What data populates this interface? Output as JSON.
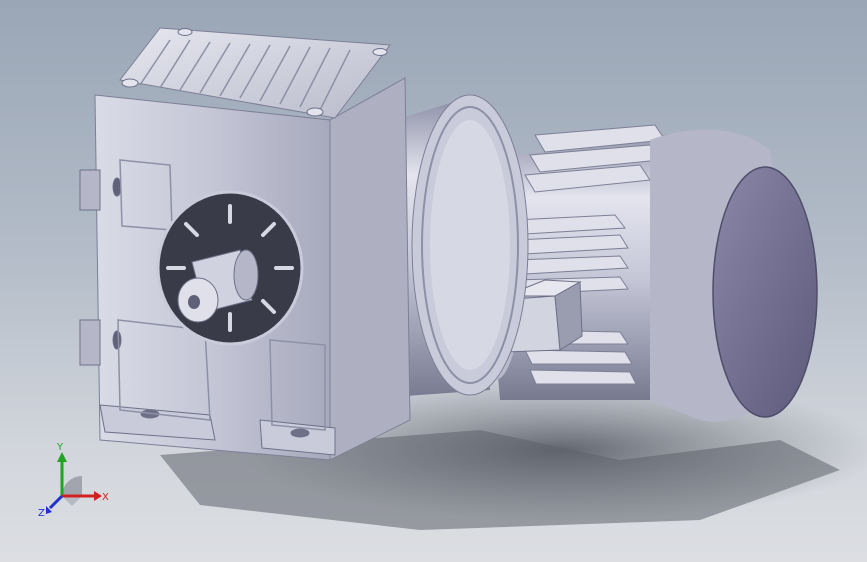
{
  "triad": {
    "x_label": "X",
    "y_label": "Y",
    "z_label": "Z",
    "x_color": "#d42020",
    "y_color": "#1fa51f",
    "z_color": "#2030d0"
  },
  "colors": {
    "body": "#c7c9d8",
    "body_shade": "#9a9cb0",
    "body_dark": "#6e7088",
    "motor_cap": "#6f6c8e",
    "shadow": "#5b5f68"
  }
}
